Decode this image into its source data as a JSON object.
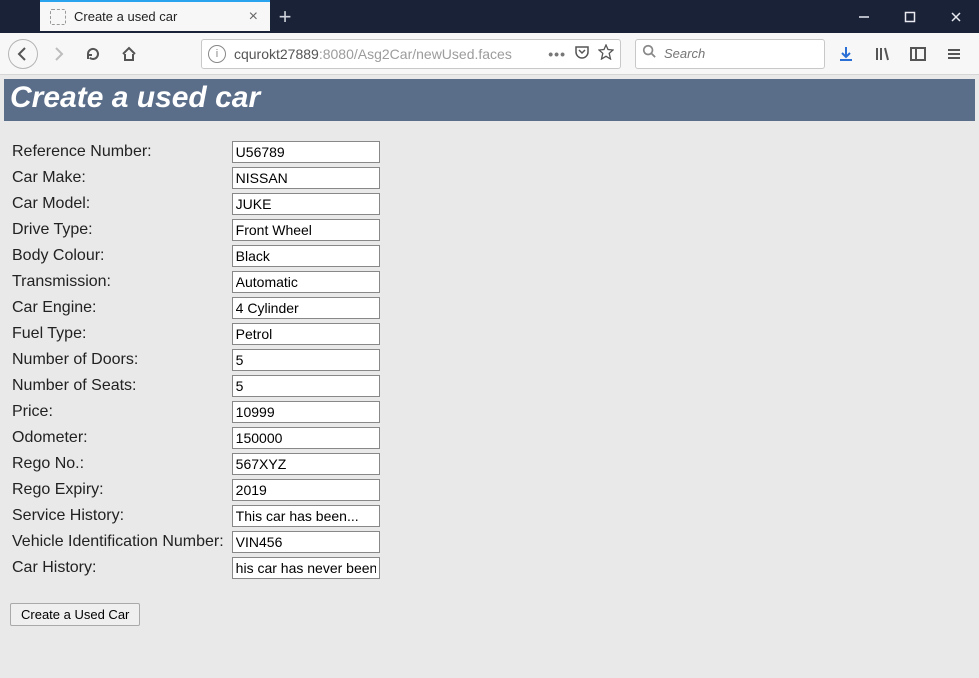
{
  "browser": {
    "tab_title": "Create a used car",
    "url_host": "cqurokt27889",
    "url_port": ":8080",
    "url_path": "/Asg2Car/newUsed.faces",
    "search_placeholder": "Search"
  },
  "page": {
    "title": "Create a used car",
    "submit_label": "Create a Used Car"
  },
  "form": {
    "reference_number": {
      "label": "Reference Number:",
      "value": "U56789"
    },
    "car_make": {
      "label": "Car Make:",
      "value": "NISSAN"
    },
    "car_model": {
      "label": "Car Model:",
      "value": "JUKE"
    },
    "drive_type": {
      "label": "Drive Type:",
      "value": "Front Wheel"
    },
    "body_colour": {
      "label": "Body Colour:",
      "value": "Black"
    },
    "transmission": {
      "label": "Transmission:",
      "value": "Automatic"
    },
    "car_engine": {
      "label": "Car Engine:",
      "value": "4 Cylinder"
    },
    "fuel_type": {
      "label": "Fuel Type:",
      "value": "Petrol"
    },
    "num_doors": {
      "label": "Number of Doors:",
      "value": "5"
    },
    "num_seats": {
      "label": "Number of Seats:",
      "value": "5"
    },
    "price": {
      "label": "Price:",
      "value": "10999"
    },
    "odometer": {
      "label": "Odometer:",
      "value": "150000"
    },
    "rego_no": {
      "label": "Rego No.:",
      "value": "567XYZ"
    },
    "rego_expiry": {
      "label": "Rego Expiry:",
      "value": "2019"
    },
    "service_history": {
      "label": "Service History:",
      "value": "This car has been..."
    },
    "vin": {
      "label": "Vehicle Identification Number:",
      "value": "VIN456"
    },
    "car_history": {
      "label": "Car History:",
      "value": "his car has never been..."
    }
  }
}
